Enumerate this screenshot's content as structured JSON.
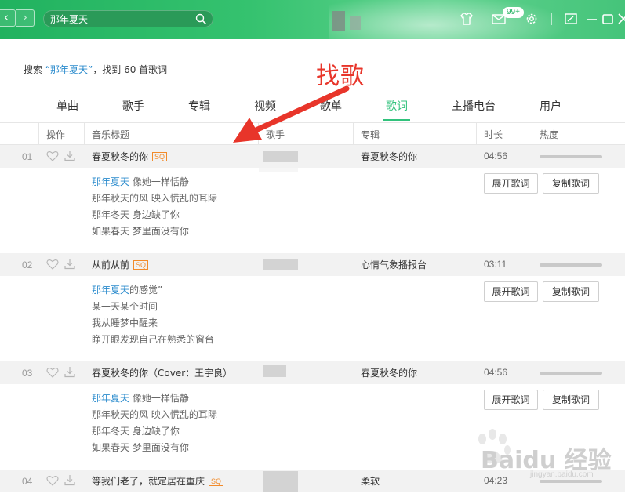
{
  "titlebar": {
    "search_value": "那年夏天",
    "mail_badge": "99+",
    "icons": [
      "back-icon",
      "forward-icon",
      "search-icon",
      "skin-icon",
      "mail-icon",
      "settings-icon",
      "mini-mode-icon",
      "minimize-icon",
      "maximize-icon",
      "close-icon"
    ]
  },
  "summary": {
    "prefix": "搜索 ",
    "keyword": "“那年夏天”",
    "suffix": "，找到 60 首歌词"
  },
  "annotation": {
    "text": "找歌",
    "color": "#e8352a"
  },
  "tabs": [
    {
      "label": "单曲",
      "active": false
    },
    {
      "label": "歌手",
      "active": false
    },
    {
      "label": "专辑",
      "active": false
    },
    {
      "label": "视频",
      "active": false
    },
    {
      "label": "歌单",
      "active": false
    },
    {
      "label": "歌词",
      "active": true
    },
    {
      "label": "主播电台",
      "active": false
    },
    {
      "label": "用户",
      "active": false
    }
  ],
  "columns": {
    "actions": "操作",
    "title": "音乐标题",
    "singer": "歌手",
    "album": "专辑",
    "duration": "时长",
    "heat": "热度"
  },
  "buttons": {
    "expand": "展开歌词",
    "copy": "复制歌词"
  },
  "quality_badge": "SQ",
  "songs": [
    {
      "num": "01",
      "title": "春夏秋冬的你",
      "sq": true,
      "album": "春夏秋冬的你",
      "duration": "04:56",
      "lyrics": [
        {
          "hl": "那年夏天",
          "rest": " 像她一样恬静"
        },
        {
          "hl": "",
          "rest": "那年秋天的风 映入慌乱的耳际"
        },
        {
          "hl": "",
          "rest": "那年冬天 身边缺了你"
        },
        {
          "hl": "",
          "rest": "如果春天 梦里面没有你"
        }
      ]
    },
    {
      "num": "02",
      "title": "从前从前",
      "sq": true,
      "album": "心情气象播报台",
      "duration": "03:11",
      "lyrics": [
        {
          "hl": "那年夏天",
          "rest": "的感觉”"
        },
        {
          "hl": "",
          "rest": "某一天某个时间"
        },
        {
          "hl": "",
          "rest": "我从睡梦中醒来"
        },
        {
          "hl": "",
          "rest": "睁开眼发现自己在熟悉的窗台"
        }
      ]
    },
    {
      "num": "03",
      "title": "春夏秋冬的你（Cover：王宇良）",
      "sq": false,
      "album": "春夏秋冬的你",
      "duration": "04:56",
      "lyrics": [
        {
          "hl": "那年夏天",
          "rest": " 像她一样恬静"
        },
        {
          "hl": "",
          "rest": "那年秋天的风 映入慌乱的耳际"
        },
        {
          "hl": "",
          "rest": "那年冬天 身边缺了你"
        },
        {
          "hl": "",
          "rest": "如果春天 梦里面没有你"
        }
      ]
    },
    {
      "num": "04",
      "title": "等我们老了，就定居在重庆",
      "sq": true,
      "album": "柔软",
      "duration": "04:23",
      "lyrics": []
    }
  ],
  "watermark": {
    "brand": "Baidu 经验",
    "url": "jingyan.baidu.com"
  }
}
